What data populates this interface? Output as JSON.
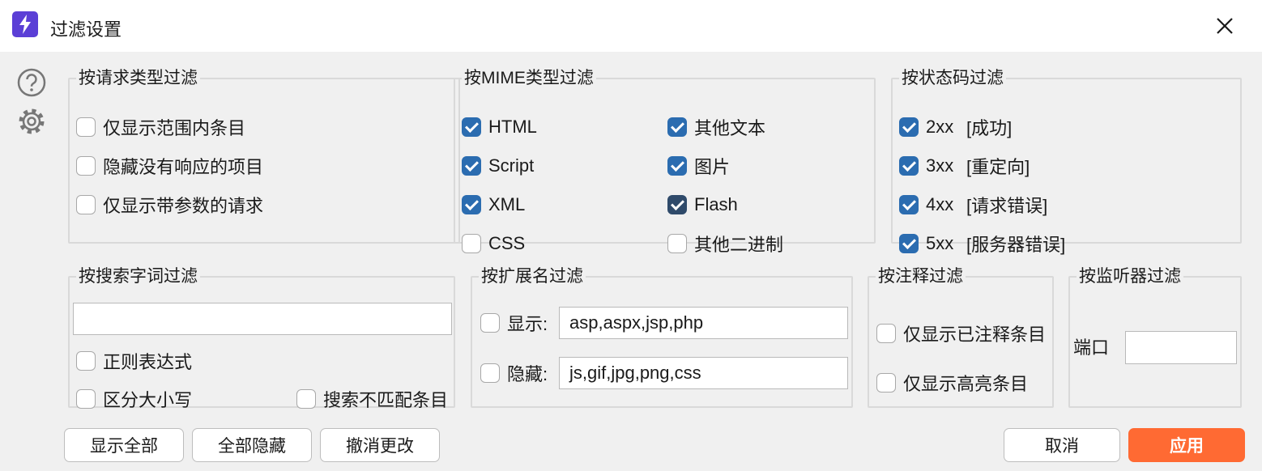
{
  "window": {
    "title": "过滤设置"
  },
  "colors": {
    "accent": "#5b3fd6",
    "checkbox": "#2b6cb0",
    "apply": "#ff6a33"
  },
  "icons": [
    "lightning-icon",
    "close-icon",
    "help-icon",
    "gear-icon"
  ],
  "request_type": {
    "title": "按请求类型过滤",
    "items": [
      {
        "label": "仅显示范围内条目",
        "checked": false
      },
      {
        "label": "隐藏没有响应的项目",
        "checked": false
      },
      {
        "label": "仅显示带参数的请求",
        "checked": false
      }
    ]
  },
  "mime": {
    "title": "按MIME类型过滤",
    "items": [
      {
        "label": "HTML",
        "checked": true
      },
      {
        "label": "Script",
        "checked": true
      },
      {
        "label": "XML",
        "checked": true
      },
      {
        "label": "CSS",
        "checked": false
      },
      {
        "label": "其他文本",
        "checked": true
      },
      {
        "label": "图片",
        "checked": true
      },
      {
        "label": "Flash",
        "checked": true
      },
      {
        "label": "其他二进制",
        "checked": false
      }
    ]
  },
  "status": {
    "title": "按状态码过滤",
    "items": [
      {
        "code": "2xx",
        "label": "[成功]",
        "checked": true
      },
      {
        "code": "3xx",
        "label": "[重定向]",
        "checked": true
      },
      {
        "code": "4xx",
        "label": "[请求错误]",
        "checked": true
      },
      {
        "code": "5xx",
        "label": "[服务器错误]",
        "checked": true
      }
    ]
  },
  "search": {
    "title": "按搜索字词过滤",
    "value": "",
    "regex_label": "正则表达式",
    "case_label": "区分大小写",
    "negative_label": "搜索不匹配条目"
  },
  "extension": {
    "title": "按扩展名过滤",
    "show_label": "显示:",
    "show_value": "asp,aspx,jsp,php",
    "hide_label": "隐藏:",
    "hide_value": "js,gif,jpg,png,css"
  },
  "annotation": {
    "title": "按注释过滤",
    "commented_label": "仅显示已注释条目",
    "highlighted_label": "仅显示高亮条目"
  },
  "listener": {
    "title": "按监听器过滤",
    "port_label": "端口",
    "port_value": ""
  },
  "buttons": {
    "show_all": "显示全部",
    "hide_all": "全部隐藏",
    "revert": "撤消更改",
    "cancel": "取消",
    "apply": "应用"
  }
}
